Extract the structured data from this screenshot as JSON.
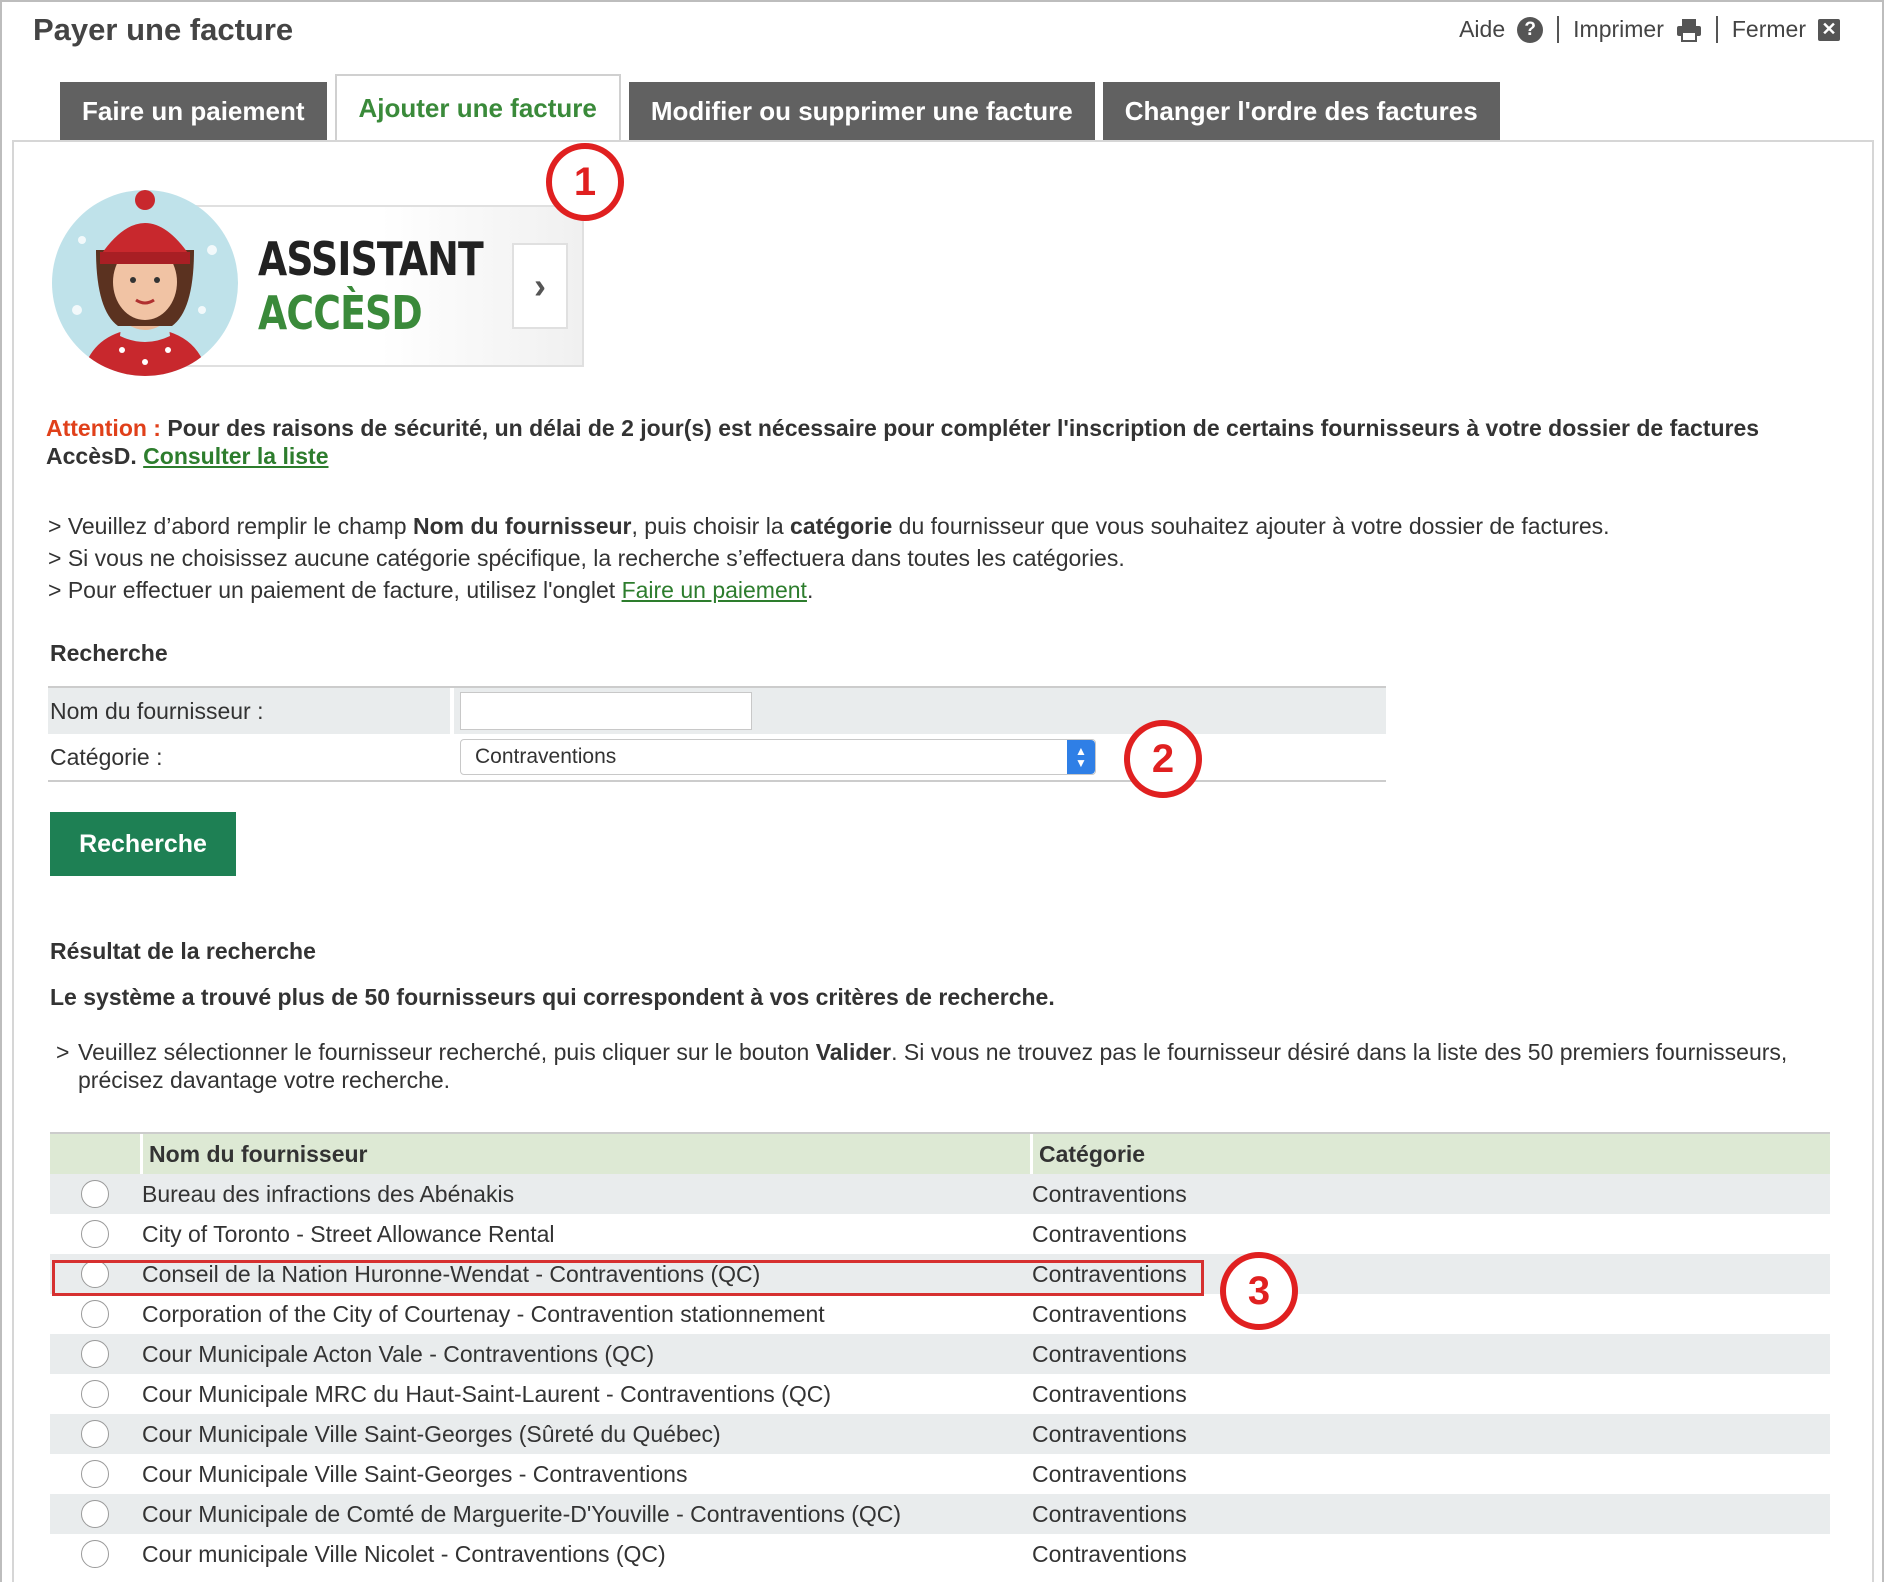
{
  "header": {
    "title": "Payer une facture",
    "help_label": "Aide",
    "help_icon": "?",
    "print_label": "Imprimer",
    "close_label": "Fermer",
    "close_icon": "✕"
  },
  "tabs": [
    {
      "label": "Faire un paiement",
      "active": false
    },
    {
      "label": "Ajouter une facture",
      "active": true
    },
    {
      "label": "Modifier ou supprimer une facture",
      "active": false
    },
    {
      "label": "Changer l'ordre des factures",
      "active": false
    }
  ],
  "annotations": [
    "1",
    "2",
    "3"
  ],
  "banner": {
    "line1": "ASSISTANT",
    "line2": "ACCÈSD",
    "arrow": "›"
  },
  "attention": {
    "label": "Attention :",
    "text": " Pour des raisons de sécurité, un délai de 2 jour(s) est nécessaire pour compléter l'inscription de certains fournisseurs à votre dossier de factures AccèsD. ",
    "link": "Consulter la liste"
  },
  "instructions": {
    "line1_pre": "> Veuillez d’abord remplir le champ ",
    "line1_b1": "Nom du fournisseur",
    "line1_mid": ", puis choisir la ",
    "line1_b2": "catégorie",
    "line1_post": " du fournisseur que vous souhaitez ajouter à votre dossier de factures.",
    "line2": "> Si vous ne choisissez aucune catégorie spécifique, la recherche s’effectuera dans toutes les catégories.",
    "line3_pre": "> Pour effectuer un paiement de facture, utilisez l'onglet ",
    "line3_link": "Faire un paiement",
    "line3_post": "."
  },
  "search": {
    "title": "Recherche",
    "name_label": "Nom du fournisseur :",
    "name_value": "",
    "category_label": "Catégorie :",
    "category_value": "Contraventions",
    "button": "Recherche"
  },
  "results": {
    "title": "Résultat de la recherche",
    "found": "Le système a trouvé plus de 50 fournisseurs qui correspondent à vos critères de recherche.",
    "instr_chev": ">",
    "instr_pre": "Veuillez sélectionner le fournisseur recherché, puis cliquer sur le bouton ",
    "instr_bold": "Valider",
    "instr_post": ". Si vous ne trouvez pas le fournisseur désiré dans la liste des 50 premiers fournisseurs, précisez davantage votre recherche.",
    "col_name": "Nom du fournisseur",
    "col_category": "Catégorie",
    "rows": [
      {
        "name": "Bureau des infractions des Abénakis",
        "category": "Contraventions"
      },
      {
        "name": "City of Toronto - Street Allowance Rental",
        "category": "Contraventions"
      },
      {
        "name": "Conseil de la Nation Huronne-Wendat - Contraventions (QC)",
        "category": "Contraventions"
      },
      {
        "name": "Corporation of the City of Courtenay - Contravention stationnement",
        "category": "Contraventions"
      },
      {
        "name": "Cour Municipale Acton Vale - Contraventions (QC)",
        "category": "Contraventions"
      },
      {
        "name": "Cour Municipale MRC du Haut-Saint-Laurent - Contraventions (QC)",
        "category": "Contraventions"
      },
      {
        "name": "Cour Municipale Ville Saint-Georges (Sûreté du Québec)",
        "category": "Contraventions"
      },
      {
        "name": "Cour Municipale Ville Saint-Georges - Contraventions",
        "category": "Contraventions"
      },
      {
        "name": "Cour Municipale de Comté de Marguerite-D'Youville - Contraventions (QC)",
        "category": "Contraventions"
      },
      {
        "name": "Cour municipale Ville Nicolet - Contraventions (QC)",
        "category": "Contraventions"
      }
    ]
  },
  "colors": {
    "accent_green": "#1e8054",
    "tab_dark": "#616161",
    "annotation_red": "#e02020",
    "attention_orange": "#e0401a"
  }
}
